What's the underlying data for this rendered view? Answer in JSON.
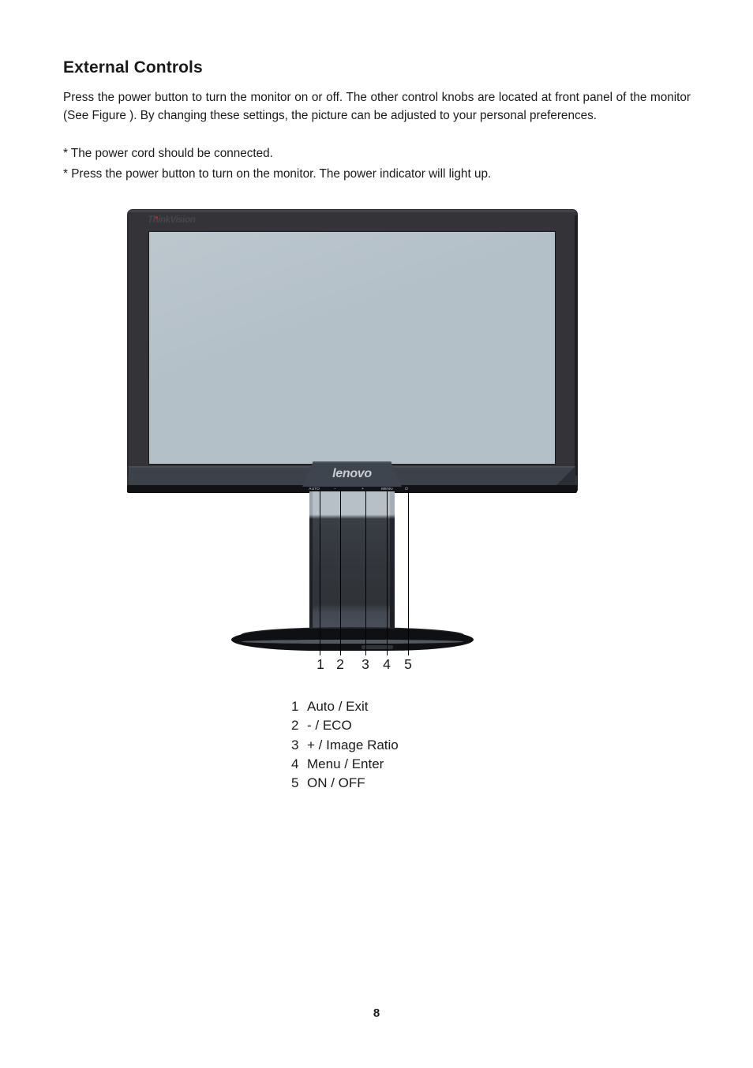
{
  "document": {
    "heading": "External Controls",
    "paragraph": "Press the power button to turn the monitor on or off. The other control knobs are located at front panel of the monitor (See Figure ). By changing these settings, the picture can be adjusted to your personal preferences.",
    "notes": [
      "* The power cord should be connected.",
      "* Press the power button to turn on the monitor. The power indicator will light up."
    ],
    "page_number": "8"
  },
  "figure": {
    "brand_logo": "ThinkVision",
    "vendor_logo": "lenovo",
    "callout_numbers": [
      "1",
      "2",
      "3",
      "4",
      "5"
    ],
    "button_glyphs": [
      "AUTO",
      "−",
      "+",
      "MENU",
      "⏻"
    ],
    "colors": {
      "bezel": "#343438",
      "bottom_bezel": "#3c424a",
      "screen": "#b4c0c8",
      "base": "#0f1014",
      "accent_red": "#c4202a"
    }
  },
  "legend": {
    "items": [
      {
        "index": "1",
        "label": "Auto / Exit"
      },
      {
        "index": "2",
        "label": "- / ECO"
      },
      {
        "index": "3",
        "label": "+ / Image Ratio"
      },
      {
        "index": "4",
        "label": "Menu / Enter"
      },
      {
        "index": "5",
        "label": "ON / OFF"
      }
    ]
  }
}
